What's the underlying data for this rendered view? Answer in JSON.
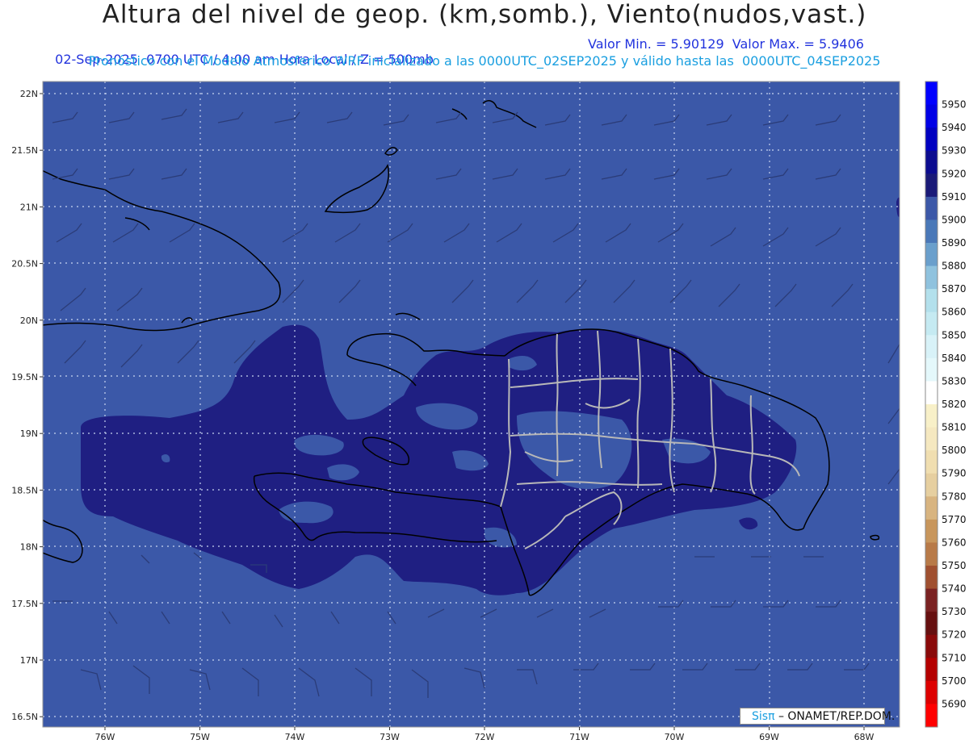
{
  "header": {
    "title": "Altura del nivel de geop. (km,somb.), Viento(nudos,vast.)",
    "subtitle_left": "02-Sep-2025  0700 UTC / 4:00 am Hora Local / Z = 500mb",
    "subtitle_right": "Valor Min. = 5.90129  Valor Max. = 5.9406",
    "subtitle2": "Pronóstico con el Modelo Atmosferico WRF inicializado a las 0000UTC_02SEP2025 y válido hasta las  0000UTC_04SEP2025"
  },
  "axes": {
    "lat_labels": [
      "22N",
      "21.5N",
      "21N",
      "20.5N",
      "20N",
      "19.5N",
      "19N",
      "18.5N",
      "18N",
      "17.5N",
      "17N",
      "16.5N"
    ],
    "lon_labels": [
      "76W",
      "75W",
      "74W",
      "73W",
      "72W",
      "71W",
      "70W",
      "69W",
      "68W"
    ]
  },
  "colorbar": {
    "levels": [
      5950,
      5940,
      5930,
      5920,
      5910,
      5900,
      5890,
      5880,
      5870,
      5860,
      5850,
      5840,
      5830,
      5820,
      5810,
      5800,
      5790,
      5780,
      5770,
      5760,
      5750,
      5740,
      5730,
      5720,
      5710,
      5700,
      5690
    ],
    "colors": [
      "#0000ff",
      "#0000e6",
      "#0000c0",
      "#0c0c90",
      "#1a1a78",
      "#3c58a8",
      "#4a78b8",
      "#6a9fcc",
      "#8fc2de",
      "#b3e0ec",
      "#c5eaf2",
      "#d8f2f8",
      "#e4f8fb",
      "#ffffff",
      "#f8f0c8",
      "#f5e8c0",
      "#f0deb0",
      "#e6cfa0",
      "#d8b480",
      "#c8965c",
      "#b87a48",
      "#a05030",
      "#7a2222",
      "#661010",
      "#8a0a0a",
      "#b40000",
      "#dd0000",
      "#ff0000"
    ]
  },
  "credit": {
    "sis": "Sisπ",
    "text": " – ONAMET/REP.DOM."
  }
}
